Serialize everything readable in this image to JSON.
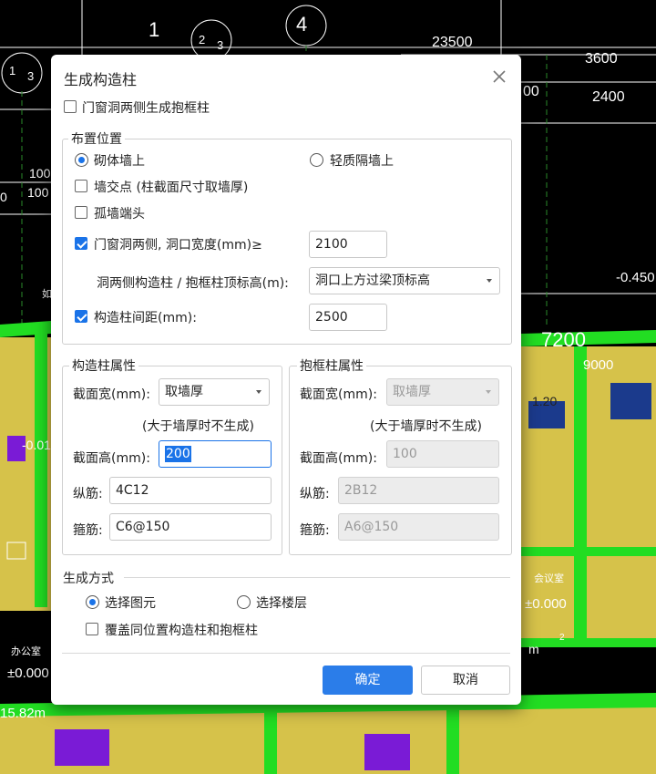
{
  "cad": {
    "labels": [
      "1",
      "2",
      "3",
      "4",
      "1",
      "3",
      "23500",
      "3600",
      "2400",
      "00",
      "100",
      "100",
      "0",
      "-0.450",
      "7200",
      "9000",
      "-0.01",
      "1.20",
      "±0.000",
      "±0.000",
      "15.82m",
      "办公室",
      "会议室",
      "m",
      "2",
      "如"
    ],
    "colors": {
      "background": "#000000",
      "wall": "#22dd22",
      "slab": "#d6c24a",
      "column": "#7a1bd6"
    }
  },
  "dialog": {
    "title": "生成构造柱",
    "close_icon": "close-icon",
    "top_checkbox": {
      "label": "门窗洞两侧生成抱框柱",
      "checked": false
    },
    "placement": {
      "legend": "布置位置",
      "radio_masonry": {
        "label": "砌体墙上",
        "selected": true
      },
      "radio_light": {
        "label": "轻质隔墙上",
        "selected": false
      },
      "wall_intersection": {
        "label": "墙交点 (柱截面尺寸取墙厚)",
        "checked": false
      },
      "isolated_wall_end": {
        "label": "孤墙端头",
        "checked": false
      },
      "opening_sides": {
        "label": "门窗洞两侧, 洞口宽度(mm)≥",
        "checked": true,
        "value": "2100"
      },
      "top_elevation": {
        "label": "洞两侧构造柱 / 抱框柱顶标高(m):",
        "value": "洞口上方过梁顶标高"
      },
      "spacing": {
        "label": "构造柱间距(mm):",
        "checked": true,
        "value": "2500"
      }
    },
    "column_props": {
      "legend": "构造柱属性",
      "width_label": "截面宽(mm):",
      "width_value": "取墙厚",
      "note": "(大于墙厚时不生成)",
      "height_label": "截面高(mm):",
      "height_value": "200",
      "long_bar_label": "纵筋:",
      "long_bar_value": "4C12",
      "stirrup_label": "箍筋:",
      "stirrup_value": "C6@150"
    },
    "frame_props": {
      "legend": "抱框柱属性",
      "width_label": "截面宽(mm):",
      "width_value": "取墙厚",
      "note": "(大于墙厚时不生成)",
      "height_label": "截面高(mm):",
      "height_value": "100",
      "long_bar_label": "纵筋:",
      "long_bar_value": "2B12",
      "stirrup_label": "箍筋:",
      "stirrup_value": "A6@150"
    },
    "generate_mode": {
      "legend": "生成方式",
      "radio_select_element": {
        "label": "选择图元",
        "selected": true
      },
      "radio_select_floor": {
        "label": "选择楼层",
        "selected": false
      },
      "overwrite": {
        "label": "覆盖同位置构造柱和抱框柱",
        "checked": false
      }
    },
    "buttons": {
      "ok": "确定",
      "cancel": "取消"
    },
    "accent_color": "#2b7de9"
  }
}
